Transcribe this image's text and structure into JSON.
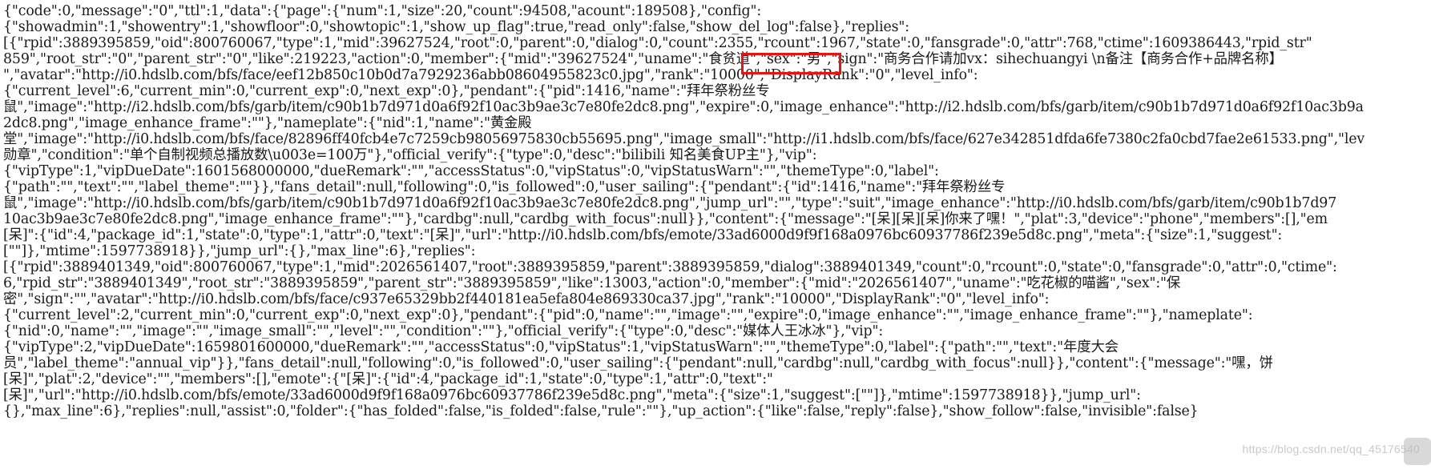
{
  "document": {
    "kind": "raw-json-response-dump",
    "lines": [
      "{\"code\":0,\"message\":\"0\",\"ttl\":1,\"data\":{\"page\":{\"num\":1,\"size\":20,\"count\":94508,\"acount\":189508},\"config\":",
      "{\"showadmin\":1,\"showentry\":1,\"showfloor\":0,\"showtopic\":1,\"show_up_flag\":true,\"read_only\":false,\"show_del_log\":false},\"replies\":",
      "[{\"rpid\":3889395859,\"oid\":800760067,\"type\":1,\"mid\":39627524,\"root\":0,\"parent\":0,\"dialog\":0,\"count\":2355,\"rcount\":1967,\"state\":0,\"fansgrade\":0,\"attr\":768,\"ctime\":1609386443,\"rpid_str\"",
      "859\",\"root_str\":\"0\",\"parent_str\":\"0\",\"like\":219223,\"action\":0,\"member\":{\"mid\":\"39627524\",\"uname\":\"食贫道\",\"sex\":\"男\",\"sign\":\"商务合作请加vx：sihechuangyi \\n备注【商务合作+品牌名称】",
      "\",\"avatar\":\"http://i0.hdslb.com/bfs/face/eef12b850c10b0d7a7929236abb08604955823c0.jpg\",\"rank\":\"10000\",\"DisplayRank\":\"0\",\"level_info\":",
      "{\"current_level\":6,\"current_min\":0,\"current_exp\":0,\"next_exp\":0},\"pendant\":{\"pid\":1416,\"name\":\"拜年祭粉丝专",
      "鼠\",\"image\":\"http://i2.hdslb.com/bfs/garb/item/c90b1b7d971d0a6f92f10ac3b9ae3c7e80fe2dc8.png\",\"expire\":0,\"image_enhance\":\"http://i2.hdslb.com/bfs/garb/item/c90b1b7d971d0a6f92f10ac3b9a",
      "2dc8.png\",\"image_enhance_frame\":\"\"},\"nameplate\":{\"nid\":1,\"name\":\"黄金殿",
      "堂\",\"image\":\"http://i0.hdslb.com/bfs/face/82896ff40fcb4e7c7259cb98056975830cb55695.png\",\"image_small\":\"http://i1.hdslb.com/bfs/face/627e342851dfda6fe7380c2fa0cbd7fae2e61533.png\",\"lev",
      "勋章\",\"condition\":\"单个自制视频总播放数\\u003e=100万\"},\"official_verify\":{\"type\":0,\"desc\":\"bilibili 知名美食UP主\"},\"vip\":",
      "{\"vipType\":1,\"vipDueDate\":1601568000000,\"dueRemark\":\"\",\"accessStatus\":0,\"vipStatus\":0,\"vipStatusWarn\":\"\",\"themeType\":0,\"label\":",
      "{\"path\":\"\",\"text\":\"\",\"label_theme\":\"\"}},\"fans_detail\":null,\"following\":0,\"is_followed\":0,\"user_sailing\":{\"pendant\":{\"id\":1416,\"name\":\"拜年祭粉丝专",
      "鼠\",\"image\":\"http://i0.hdslb.com/bfs/garb/item/c90b1b7d971d0a6f92f10ac3b9ae3c7e80fe2dc8.png\",\"jump_url\":\"\",\"type\":\"suit\",\"image_enhance\":\"http://i0.hdslb.com/bfs/garb/item/c90b1b7d97",
      "10ac3b9ae3c7e80fe2dc8.png\",\"image_enhance_frame\":\"\"},\"cardbg\":null,\"cardbg_with_focus\":null}},\"content\":{\"message\":\"[呆][呆][呆]你来了嘿！\",\"plat\":3,\"device\":\"phone\",\"members\":[],\"em",
      "[呆]\":{\"id\":4,\"package_id\":1,\"state\":0,\"type\":1,\"attr\":0,\"text\":\"[呆]\",\"url\":\"http://i0.hdslb.com/bfs/emote/33ad6000d9f9f168a0976bc60937786f239e5d8c.png\",\"meta\":{\"size\":1,\"suggest\":",
      "[\"\"]},\"mtime\":1597738918}},\"jump_url\":{},\"max_line\":6},\"replies\":",
      "[{\"rpid\":3889401349,\"oid\":800760067,\"type\":1,\"mid\":2026561407,\"root\":3889395859,\"parent\":3889395859,\"dialog\":3889401349,\"count\":0,\"rcount\":0,\"state\":0,\"fansgrade\":0,\"attr\":0,\"ctime\":",
      "6,\"rpid_str\":\"3889401349\",\"root_str\":\"3889395859\",\"parent_str\":\"3889395859\",\"like\":13003,\"action\":0,\"member\":{\"mid\":\"2026561407\",\"uname\":\"吃花椒的喵酱\",\"sex\":\"保",
      "密\",\"sign\":\"\",\"avatar\":\"http://i0.hdslb.com/bfs/face/c937e65329bb2f440181ea5efa804e869330ca37.jpg\",\"rank\":\"10000\",\"DisplayRank\":\"0\",\"level_info\":",
      "{\"current_level\":2,\"current_min\":0,\"current_exp\":0,\"next_exp\":0},\"pendant\":{\"pid\":0,\"name\":\"\",\"image\":\"\",\"expire\":0,\"image_enhance\":\"\",\"image_enhance_frame\":\"\"},\"nameplate\":",
      "{\"nid\":0,\"name\":\"\",\"image\":\"\",\"image_small\":\"\",\"level\":\"\",\"condition\":\"\"},\"official_verify\":{\"type\":0,\"desc\":\"媒体人王冰冰\"},\"vip\":",
      "{\"vipType\":2,\"vipDueDate\":1659801600000,\"dueRemark\":\"\",\"accessStatus\":0,\"vipStatus\":1,\"vipStatusWarn\":\"\",\"themeType\":0,\"label\":{\"path\":\"\",\"text\":\"年度大会",
      "员\",\"label_theme\":\"annual_vip\"}},\"fans_detail\":null,\"following\":0,\"is_followed\":0,\"user_sailing\":{\"pendant\":null,\"cardbg\":null,\"cardbg_with_focus\":null}},\"content\":{\"message\":\"嘿，饼",
      "[呆]\",\"plat\":2,\"device\":\"\",\"members\":[],\"emote\":{\"[呆]\":{\"id\":4,\"package_id\":1,\"state\":0,\"type\":1,\"attr\":0,\"text\":\"",
      "[呆]\",\"url\":\"http://i0.hdslb.com/bfs/emote/33ad6000d9f9f168a0976bc60937786f239e5d8c.png\",\"meta\":{\"size\":1,\"suggest\":[\"\"]},\"mtime\":1597738918}},\"jump_url\":",
      "{},\"max_line\":6},\"replies\":null,\"assist\":0,\"folder\":{\"has_folded\":false,\"is_folded\":false,\"rule\":\"\"},\"up_action\":{\"like\":false,\"reply\":false},\"show_follow\":false,\"invisible\":false}"
    ]
  },
  "annotation": {
    "highlighted_text": "食贫道",
    "box_color": "#ee1111",
    "label": "uname-highlight"
  },
  "watermark": {
    "text": "https://blog.csdn.net/qq_45176540"
  }
}
